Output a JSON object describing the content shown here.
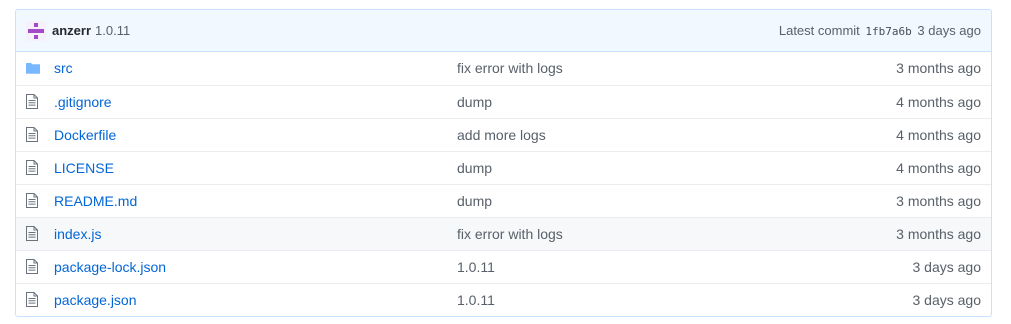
{
  "commit": {
    "author": "anzerr",
    "message": "1.0.11",
    "latest_label": "Latest commit",
    "sha": "1fb7a6b",
    "age": "3 days ago"
  },
  "files": [
    {
      "name": "src",
      "type": "directory",
      "icon": "folder-icon",
      "message": "fix error with logs",
      "age": "3 months ago"
    },
    {
      "name": ".gitignore",
      "type": "file",
      "icon": "file-icon",
      "message": "dump",
      "age": "4 months ago"
    },
    {
      "name": "Dockerfile",
      "type": "file",
      "icon": "file-icon",
      "message": "add more logs",
      "age": "4 months ago"
    },
    {
      "name": "LICENSE",
      "type": "file",
      "icon": "file-icon",
      "message": "dump",
      "age": "4 months ago"
    },
    {
      "name": "README.md",
      "type": "file",
      "icon": "file-icon",
      "message": "dump",
      "age": "3 months ago"
    },
    {
      "name": "index.js",
      "type": "file",
      "icon": "file-icon",
      "message": "fix error with logs",
      "age": "3 months ago"
    },
    {
      "name": "package-lock.json",
      "type": "file",
      "icon": "file-icon",
      "message": "1.0.11",
      "age": "3 days ago"
    },
    {
      "name": "package.json",
      "type": "file",
      "icon": "file-icon",
      "message": "1.0.11",
      "age": "3 days ago"
    }
  ],
  "colors": {
    "link": "#0366d6",
    "header_bg": "#f1f8ff",
    "border": "#c8e1ff",
    "icon": "#79b8ff",
    "avatar": "#a44ac9"
  }
}
